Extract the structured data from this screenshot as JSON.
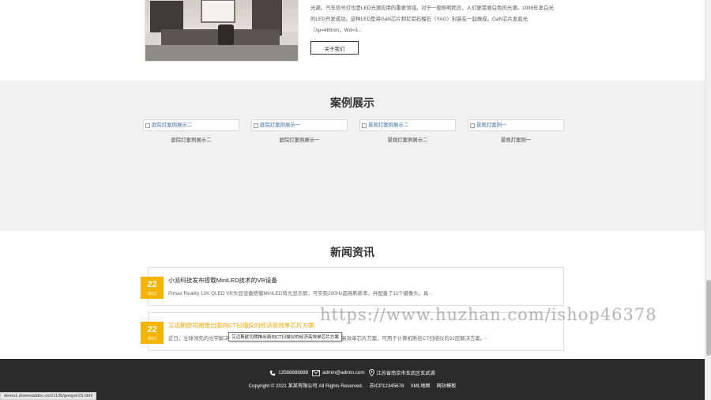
{
  "about": {
    "text_lines": [
      "光源。汽车信号灯也是LED光源应用的重要领域。对于一般照明而言，人们更需要白色的光源。1998年发白光",
      "的LED开发成功。这种LED是将GaN芯片和钇铝石榴石（YAG）封装在一起做成。GaN芯片发蓝光",
      "（λp=465nm，Wd=3..."
    ],
    "button_label": "关于我们"
  },
  "cases": {
    "title": "案例展示",
    "items": [
      {
        "alt": "庭院灯案例展示二",
        "caption": "庭院灯案例展示二"
      },
      {
        "alt": "庭院灯案例展示一",
        "caption": "庭院灯案例展示一"
      },
      {
        "alt": "景观灯案例展示二",
        "caption": "景观灯案例展示二"
      },
      {
        "alt": "景观灯案例一",
        "caption": "景观灯案例一"
      }
    ]
  },
  "news": {
    "title": "新闻资讯",
    "items": [
      {
        "day": "22",
        "year": "2021",
        "title": "小派科技发布搭载MiniLED技术的VR设备",
        "summary": "Pimax Reality 12K QLED VR头显设备搭载MiniLED背光显示屏，可实现200Hz超高刷新率，并配备了11个摄像头。具···"
      },
      {
        "day": "22",
        "year": "2021",
        "title": "艾迈斯欧司朗推出面向CT扫描仪的经济高效单芯片方案",
        "summary": "近日，全球领先的光学解决方案供应商艾迈斯欧司朗推出面向CT扫描仪的经济高效单芯片方案，可用于计算机断层CT扫描仪的32层解决方案。···"
      }
    ],
    "tooltip": "艾迈斯欧司朗推出面向CT扫描仪的经济高效单芯片方案"
  },
  "watermark": "https://www.huzhan.com/ishop46378",
  "footer": {
    "phone": "13588888888",
    "email": "admin@admin.com",
    "address": "江苏省南京市玄武区玄武湖",
    "copyright": "Copyright © 2021 某某有限公司 All Rights Reserved.",
    "icp": "苏ICP12345678",
    "xml_map": "XML地图",
    "template_link": "网站模板"
  },
  "status_url": "demo1.downsaddoc.cn/21136/gongsi/23.html",
  "colors": {
    "accent": "#f5b400",
    "footer_bg": "#2b2b2b",
    "section_bg": "#f1f1f1"
  }
}
